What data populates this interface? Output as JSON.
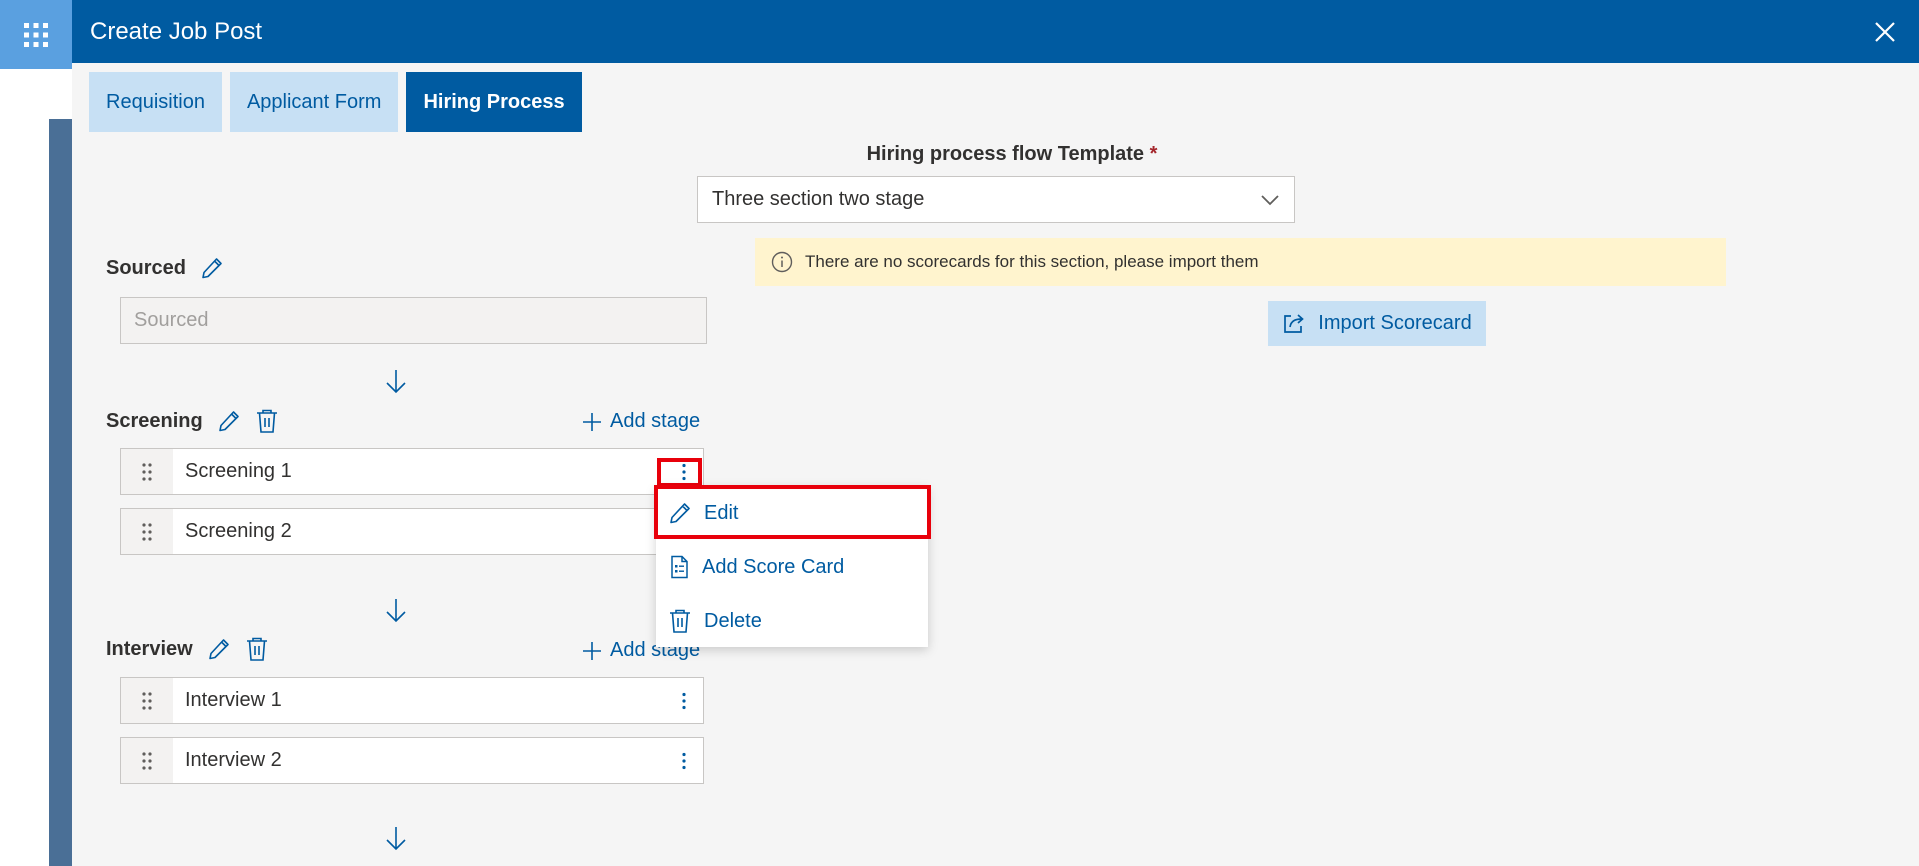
{
  "icons": {
    "app_launcher": "waffle-icon",
    "close": "close-icon",
    "edit": "pencil-icon",
    "delete": "trash-icon",
    "add": "plus-icon",
    "drag": "drag-handle-icon",
    "more": "more-vertical-icon",
    "arrow": "arrow-down-icon",
    "info": "info-icon",
    "import": "share-icon",
    "scorecard": "document-list-icon",
    "chevron": "chevron-down-icon"
  },
  "colors": {
    "header": "#005ba1",
    "accent": "#005ba1",
    "tab_inactive": "#c7e0f4",
    "info_bg": "#fff4ce",
    "highlight": "#e8000b"
  },
  "panel": {
    "title": "Create Job Post"
  },
  "tabs": [
    {
      "label": "Requisition",
      "active": false
    },
    {
      "label": "Applicant Form",
      "active": false
    },
    {
      "label": "Hiring Process",
      "active": true
    }
  ],
  "template": {
    "label": "Hiring process flow Template",
    "required_mark": "*",
    "value": "Three section two stage"
  },
  "info": {
    "message": "There are no scorecards for this section, please import them"
  },
  "import_button": {
    "label": "Import Scorecard"
  },
  "sections": {
    "sourced": {
      "title": "Sourced",
      "stage_placeholder": "Sourced"
    },
    "screening": {
      "title": "Screening",
      "add_label": "Add stage",
      "stages": [
        "Screening 1",
        "Screening 2"
      ]
    },
    "interview": {
      "title": "Interview",
      "add_label": "Add stage",
      "stages": [
        "Interview 1",
        "Interview 2"
      ]
    }
  },
  "context_menu": {
    "items": [
      {
        "label": "Edit",
        "icon": "pencil-icon"
      },
      {
        "label": "Add Score Card",
        "icon": "document-list-icon"
      },
      {
        "label": "Delete",
        "icon": "trash-icon"
      }
    ]
  }
}
